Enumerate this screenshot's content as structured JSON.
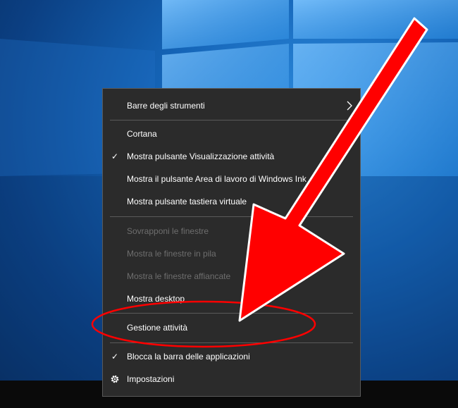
{
  "context_menu": {
    "items": [
      {
        "label": "Barre degli strumenti",
        "has_submenu": true
      },
      {
        "label": "Cortana"
      },
      {
        "label": "Mostra pulsante Visualizzazione attività",
        "checked": true
      },
      {
        "label": "Mostra il pulsante Area di lavoro di Windows Ink"
      },
      {
        "label": "Mostra pulsante tastiera virtuale"
      },
      {
        "label": "Sovrapponi le finestre",
        "disabled": true
      },
      {
        "label": "Mostra le finestre in pila",
        "disabled": true
      },
      {
        "label": "Mostra le finestre affiancate",
        "disabled": true
      },
      {
        "label": "Mostra desktop"
      },
      {
        "label": "Gestione attività",
        "highlighted_by_annotation": true
      },
      {
        "label": "Blocca la barra delle applicazioni",
        "checked": true
      },
      {
        "label": "Impostazioni",
        "icon": "gear-icon"
      }
    ]
  },
  "colors": {
    "menu_background": "#2b2b2b",
    "menu_text": "#ffffff",
    "disabled_text": "#6e6e6e",
    "annotation_red": "#ff0000"
  }
}
